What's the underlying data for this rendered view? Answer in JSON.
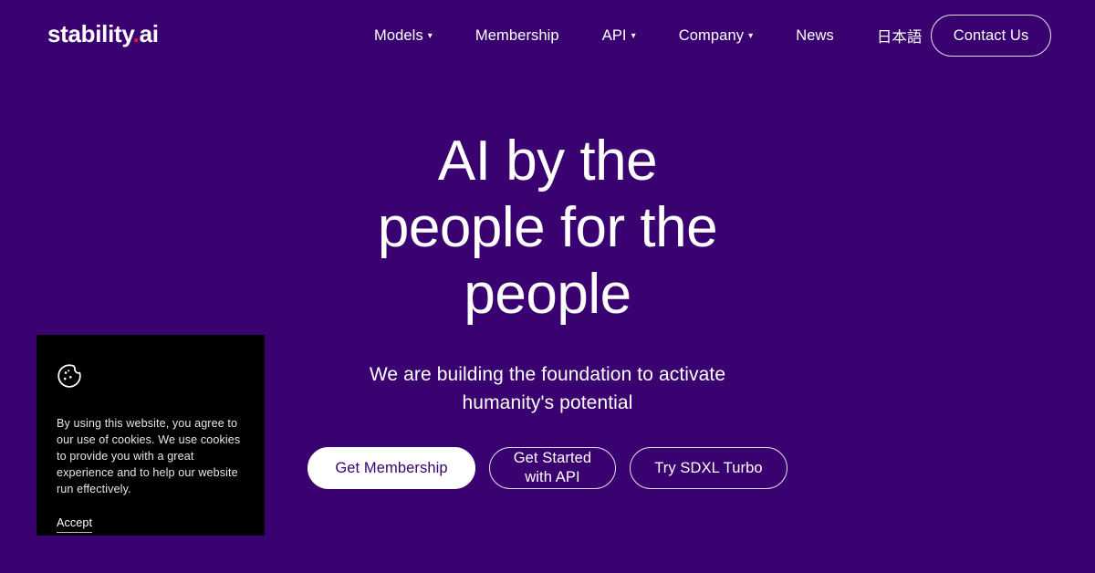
{
  "theme": {
    "background": "#3a0270",
    "accent_red": "#e8162b",
    "text_on_dark": "#ffffff",
    "banner_background": "#000000",
    "banner_text": "#e6e6e6"
  },
  "header": {
    "brand": {
      "name": "stability",
      "dot": ".",
      "suffix": "ai"
    },
    "nav": [
      {
        "label": "Models",
        "has_caret": true,
        "caret": "▾"
      },
      {
        "label": "Membership",
        "has_caret": false,
        "caret": ""
      },
      {
        "label": "API",
        "has_caret": true,
        "caret": "▾"
      },
      {
        "label": "Company",
        "has_caret": true,
        "caret": "▾"
      },
      {
        "label": "News",
        "has_caret": false,
        "caret": ""
      },
      {
        "label": "日本語",
        "has_caret": false,
        "caret": ""
      }
    ],
    "contact_button": "Contact Us"
  },
  "hero": {
    "title_line_1": "AI by the",
    "title_line_2": "people for the",
    "title_line_3": "people",
    "title_full": "AI by the people for the people",
    "subtitle": "We are building the foundation to activate humanity's potential",
    "buttons": [
      {
        "label": "Get Membership",
        "style": "primary"
      },
      {
        "label": "Get Started\nwith API",
        "style": "ghost"
      },
      {
        "label": "Try SDXL Turbo",
        "style": "ghost"
      }
    ]
  },
  "cookie_banner": {
    "icon": "cookie-icon",
    "message": "By using this website, you agree to our use of cookies. We use cookies to provide you with a great experience and to help our website run effectively.",
    "accept_label": "Accept"
  }
}
